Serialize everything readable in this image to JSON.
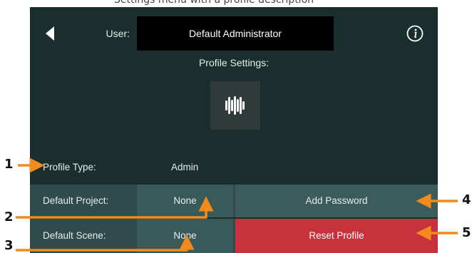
{
  "top_caption": "Settings menu with a profile description",
  "header": {
    "back_icon": "back-triangle-icon",
    "user_label": "User:",
    "user_value": "Default Administrator",
    "info_icon": "info-icon"
  },
  "profile": {
    "settings_title": "Profile Settings:",
    "logo_icon": "presonus-logo-icon",
    "type_label": "Profile Type:",
    "type_value": "Admin",
    "default_project_label": "Default Project:",
    "default_project_value": "None",
    "default_scene_label": "Default Scene:",
    "default_scene_value": "None",
    "add_password_label": "Add Password",
    "reset_profile_label": "Reset Profile"
  },
  "callouts": {
    "c1": "1",
    "c2": "2",
    "c3": "3",
    "c4": "4",
    "c5": "5"
  },
  "colors": {
    "screen_bg": "#1a2e2d",
    "row_bg": "#2f4b4b",
    "button_bg": "#3a5a5a",
    "reset_bg": "#c7323c",
    "callout_orange": "#f28a1e"
  }
}
